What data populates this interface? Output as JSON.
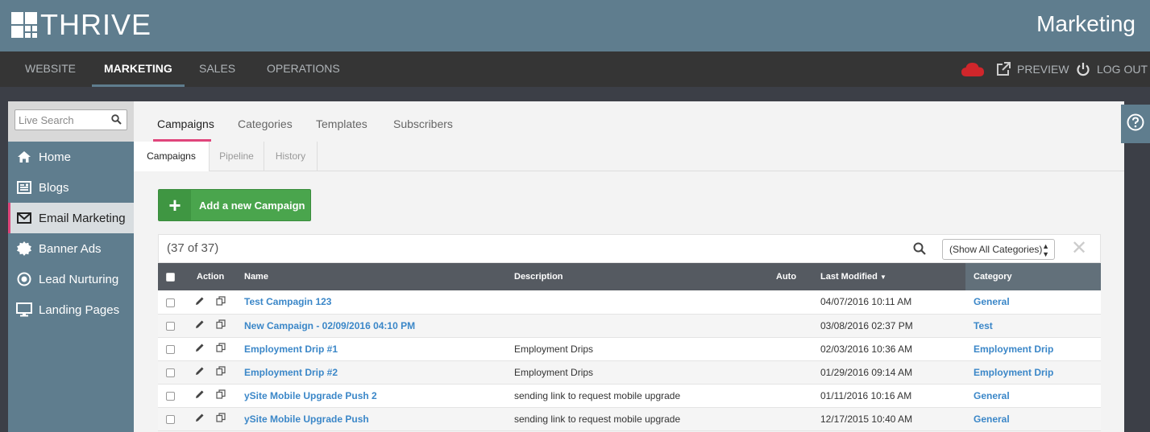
{
  "app": {
    "brand": "THRIVE",
    "section_title": "Marketing"
  },
  "topnav": {
    "items": [
      "WEBSITE",
      "MARKETING",
      "SALES",
      "OPERATIONS"
    ],
    "active": "MARKETING",
    "preview": "PREVIEW",
    "logout": "LOG OUT"
  },
  "sidebar": {
    "search_placeholder": "Live Search",
    "items": [
      {
        "label": "Home",
        "icon": "home-icon"
      },
      {
        "label": "Blogs",
        "icon": "blogs-icon"
      },
      {
        "label": "Email Marketing",
        "icon": "envelope-icon",
        "active": true
      },
      {
        "label": "Banner Ads",
        "icon": "badge-icon"
      },
      {
        "label": "Lead Nurturing",
        "icon": "target-icon"
      },
      {
        "label": "Landing Pages",
        "icon": "monitor-icon"
      }
    ]
  },
  "tabs": [
    "Campaigns",
    "Categories",
    "Templates",
    "Subscribers"
  ],
  "subtabs": [
    "Campaigns",
    "Pipeline",
    "History"
  ],
  "add_button": "Add a new Campaign",
  "list": {
    "count": "(37 of 37)",
    "category_filter": "(Show All Categories)",
    "columns": {
      "action": "Action",
      "name": "Name",
      "description": "Description",
      "auto": "Auto",
      "modified": "Last Modified",
      "category": "Category"
    },
    "rows": [
      {
        "name": "Test Campagin 123",
        "description": "",
        "modified": "04/07/2016 10:11 AM",
        "category": "General"
      },
      {
        "name": "New Campaign - 02/09/2016 04:10 PM",
        "description": "",
        "modified": "03/08/2016 02:37 PM",
        "category": "Test"
      },
      {
        "name": "Employment Drip #1",
        "description": "Employment Drips",
        "modified": "02/03/2016 10:36 AM",
        "category": "Employment Drip"
      },
      {
        "name": "Employment Drip #2",
        "description": "Employment Drips",
        "modified": "01/29/2016 09:14 AM",
        "category": "Employment Drip"
      },
      {
        "name": "ySite Mobile Upgrade Push 2",
        "description": "sending link to request mobile upgrade",
        "modified": "01/11/2016 10:16 AM",
        "category": "General"
      },
      {
        "name": "ySite Mobile Upgrade Push",
        "description": "sending link to request mobile upgrade",
        "modified": "12/17/2015 10:40 AM",
        "category": "General"
      }
    ]
  },
  "colors": {
    "header": "#5f7d8e",
    "nav": "#353535",
    "accent": "#e0457b",
    "green": "#4aa54d",
    "link": "#3b87c8"
  }
}
